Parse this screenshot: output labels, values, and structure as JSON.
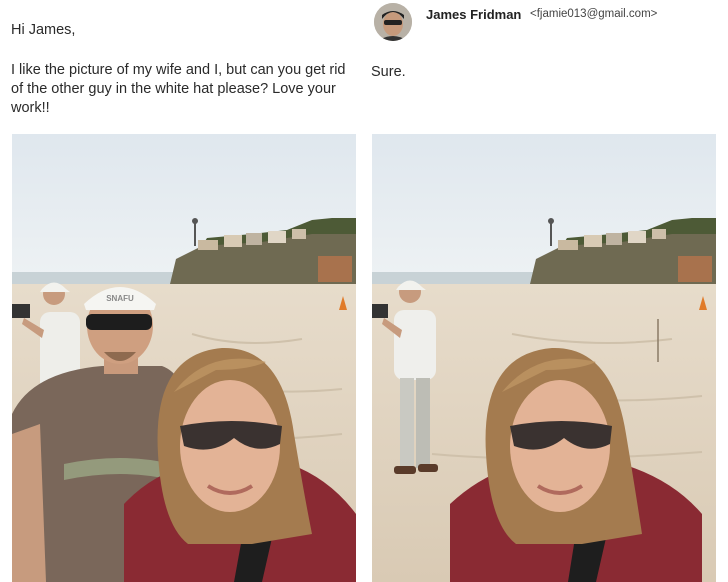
{
  "request": {
    "greeting": "Hi James,",
    "message": "I like the picture of my wife and I,  but can you get rid of the other guy in the white hat please? Love your work!!"
  },
  "reply": {
    "sender_name": "James Fridman",
    "sender_email": "<fjamie013@gmail.com>",
    "body": "Sure."
  },
  "photos": {
    "original": {
      "cap_text": "SNAFU"
    },
    "edited": {}
  }
}
